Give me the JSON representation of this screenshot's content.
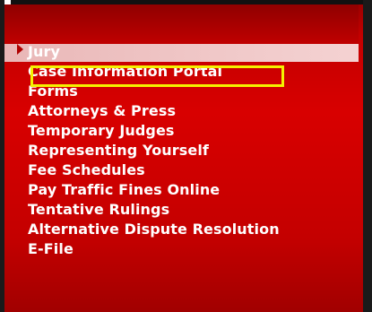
{
  "menu": {
    "items": [
      {
        "label": "Jury"
      },
      {
        "label": "Case Information Portal"
      },
      {
        "label": "Forms"
      },
      {
        "label": "Attorneys & Press"
      },
      {
        "label": "Temporary Judges"
      },
      {
        "label": "Representing Yourself"
      },
      {
        "label": "Fee Schedules"
      },
      {
        "label": "Pay Traffic Fines Online"
      },
      {
        "label": "Tentative Rulings"
      },
      {
        "label": "Alternative Dispute Resolution"
      },
      {
        "label": "E-File"
      }
    ]
  },
  "colors": {
    "menu_background": "#c80000",
    "menu_text": "#ffffff",
    "active_row": "#f0c8c8",
    "active_arrow": "#b00000",
    "highlight_box": "#f4f100"
  },
  "icons": {
    "active_indicator": "right-triangle-icon"
  }
}
